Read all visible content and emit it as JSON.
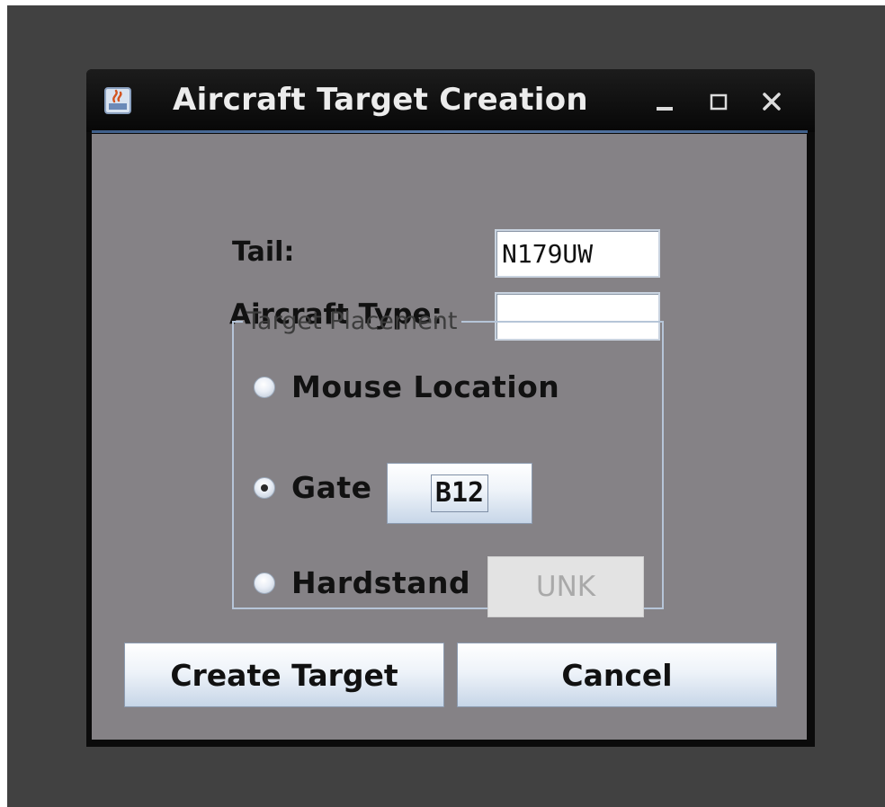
{
  "window": {
    "title": "Aircraft Target Creation",
    "minimize_symbol": "_",
    "maximize_symbol": "□",
    "close_symbol": "×"
  },
  "form": {
    "tail_label": "Tail:",
    "tail_value": "N179UW",
    "aircraft_type_label": "Aircraft Type:",
    "aircraft_type_value": ""
  },
  "target_placement": {
    "legend": "Target Placement",
    "options": [
      {
        "label": "Mouse Location",
        "selected": false
      },
      {
        "label": "Gate",
        "selected": true,
        "button_label": "B12"
      },
      {
        "label": "Hardstand",
        "selected": false,
        "button_label": "UNK",
        "button_enabled": false
      }
    ]
  },
  "actions": {
    "create_label": "Create Target",
    "cancel_label": "Cancel"
  },
  "colors": {
    "backdrop": "#414141",
    "titlebar": "#0b0b0b",
    "content_bg": "#858286",
    "accent": "#5d7fae"
  }
}
